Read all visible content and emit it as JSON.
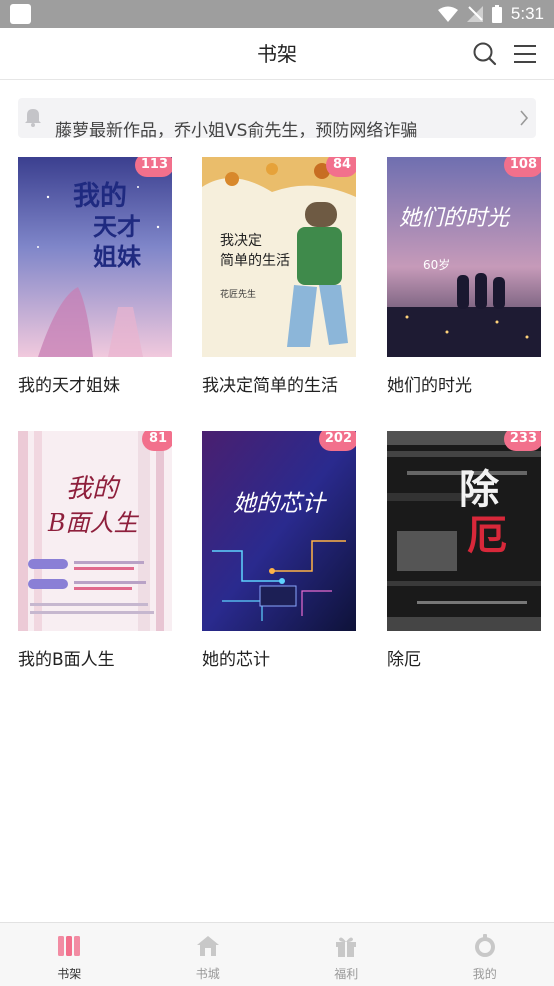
{
  "status_bar": {
    "time": "5:31"
  },
  "header": {
    "title": "书架"
  },
  "notice": {
    "text": "藤萝最新作品，乔小姐VS俞先生，预防网络诈骗"
  },
  "books": [
    {
      "title": "我的天才姐妹",
      "badge": "113"
    },
    {
      "title": "我决定简单的生活",
      "badge": "84"
    },
    {
      "title": "她们的时光",
      "badge": "108"
    },
    {
      "title": "我的B面人生",
      "badge": "81"
    },
    {
      "title": "她的芯计",
      "badge": "202"
    },
    {
      "title": "除厄",
      "badge": "233"
    }
  ],
  "covers": {
    "b0": {
      "line1": "我的",
      "line2": "天才",
      "line3": "姐妹"
    },
    "b1": {
      "line1": "我决定",
      "line2": "简单的生活",
      "author": "花匠先生"
    },
    "b2": {
      "line1": "她们的时光",
      "tag": "60岁"
    },
    "b3": {
      "line1": "我的",
      "line2": "B面人生"
    },
    "b4": {
      "line1": "她的芯计"
    },
    "b5": {
      "line1": "除",
      "line2": "厄"
    }
  },
  "tabs": [
    {
      "label": "书架",
      "icon": "bookshelf-icon",
      "active": true
    },
    {
      "label": "书城",
      "icon": "bookstore-icon",
      "active": false
    },
    {
      "label": "福利",
      "icon": "gift-icon",
      "active": false
    },
    {
      "label": "我的",
      "icon": "profile-icon",
      "active": false
    }
  ],
  "colors": {
    "accent": "#f2708c",
    "status_bar": "#9e9e9e"
  }
}
